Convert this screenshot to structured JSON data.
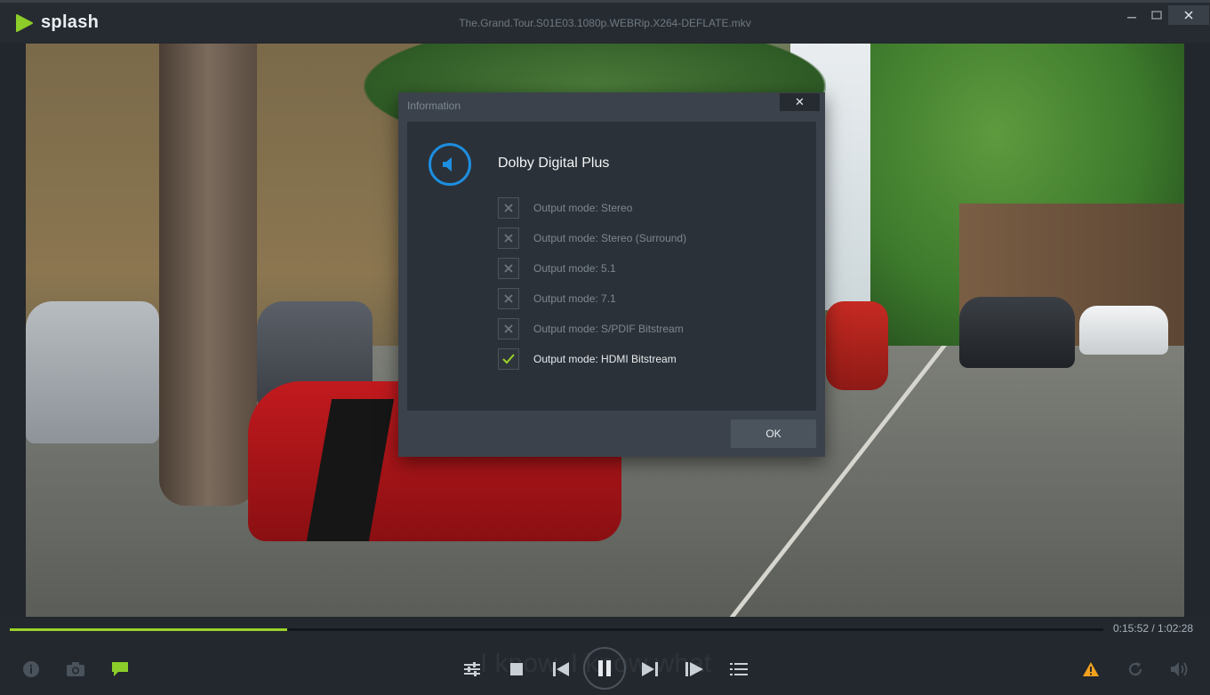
{
  "app": {
    "name": "splash",
    "file_title": "The.Grand.Tour.S01E03.1080p.WEBRip.X264-DEFLATE.mkv",
    "window_controls": {
      "minimize": "minimize-icon",
      "maximize": "maximize-icon",
      "close": "close-icon"
    }
  },
  "dialog": {
    "title": "Information",
    "close_symbol": "✕",
    "heading": "Dolby Digital Plus",
    "options": [
      {
        "label": "Output mode: Stereo",
        "checked": false
      },
      {
        "label": "Output mode: Stereo (Surround)",
        "checked": false
      },
      {
        "label": "Output mode: 5.1",
        "checked": false
      },
      {
        "label": "Output mode: 7.1",
        "checked": false
      },
      {
        "label": "Output mode: S/PDIF Bitstream",
        "checked": false
      },
      {
        "label": "Output mode: HDMI Bitstream",
        "checked": true
      }
    ],
    "ok_label": "OK"
  },
  "player": {
    "time": "0:15:52 / 1:02:28",
    "progress_fraction": 0.254,
    "subtitle_ghost": "I know, I know what",
    "accent_color": "#9bd22a",
    "controls_left": [
      "info-icon",
      "camera-icon",
      "subtitle-icon"
    ],
    "controls_center": [
      "equalizer-icon",
      "stop-icon",
      "previous-icon",
      "pause-icon",
      "next-icon",
      "frame-step-icon",
      "playlist-icon"
    ],
    "controls_right": [
      "warning-icon",
      "repeat-icon",
      "volume-icon"
    ]
  }
}
